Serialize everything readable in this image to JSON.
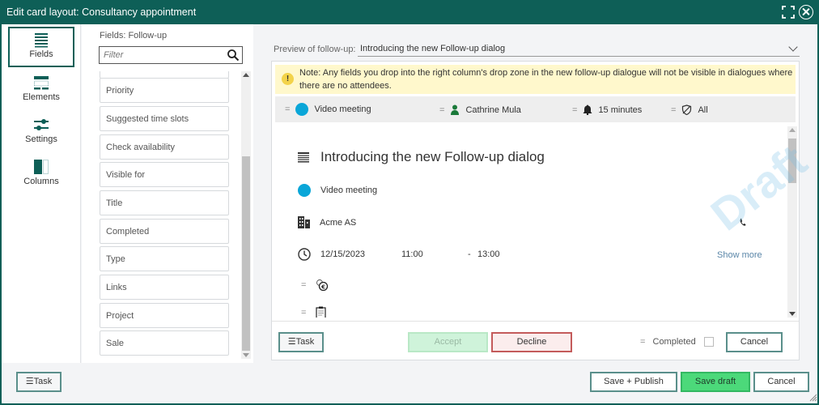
{
  "window": {
    "title": "Edit card layout: Consultancy appointment"
  },
  "nav": {
    "items": [
      {
        "label": "Fields",
        "icon": "fields-icon",
        "active": true
      },
      {
        "label": "Elements",
        "icon": "elements-icon"
      },
      {
        "label": "Settings",
        "icon": "settings-sliders-icon"
      },
      {
        "label": "Columns",
        "icon": "columns-icon"
      }
    ]
  },
  "fields_panel": {
    "label": "Fields: Follow-up",
    "filter_placeholder": "Filter",
    "items": [
      "Priority",
      "Suggested time slots",
      "Check availability",
      "Visible for",
      "Title",
      "Completed",
      "Type",
      "Links",
      "Project",
      "Sale"
    ]
  },
  "preview": {
    "label": "Preview of follow-up:",
    "selected": "Introducing the new Follow-up dialog",
    "note": "Note: Any fields you drop into the right column's drop zone in the new follow-up dialogue will not be visible in dialogues where there are no attendees.",
    "header": {
      "type": "Video meeting",
      "owner": "Cathrine Mula",
      "reminder": "15 minutes",
      "visibility": "All"
    },
    "title": "Introducing the new Follow-up dialog",
    "type": "Video meeting",
    "company": "Acme AS",
    "date": "12/15/2023",
    "start_time": "11:00",
    "time_separator": "-",
    "end_time": "13:00",
    "show_more": "Show more",
    "footer": {
      "task": "Task",
      "accept": "Accept",
      "decline": "Decline",
      "completed": "Completed",
      "completed_checked": false,
      "cancel": "Cancel"
    },
    "watermark": "Draft"
  },
  "bottom": {
    "task": "Task",
    "save_publish": "Save + Publish",
    "save_draft": "Save draft",
    "cancel": "Cancel"
  },
  "colors": {
    "titlebar": "#0e5f57",
    "accent_blue": "#0aa6d8",
    "save_draft": "#4cd97a",
    "decline_border": "#c45b5b",
    "note_bg": "#fff8cc"
  }
}
